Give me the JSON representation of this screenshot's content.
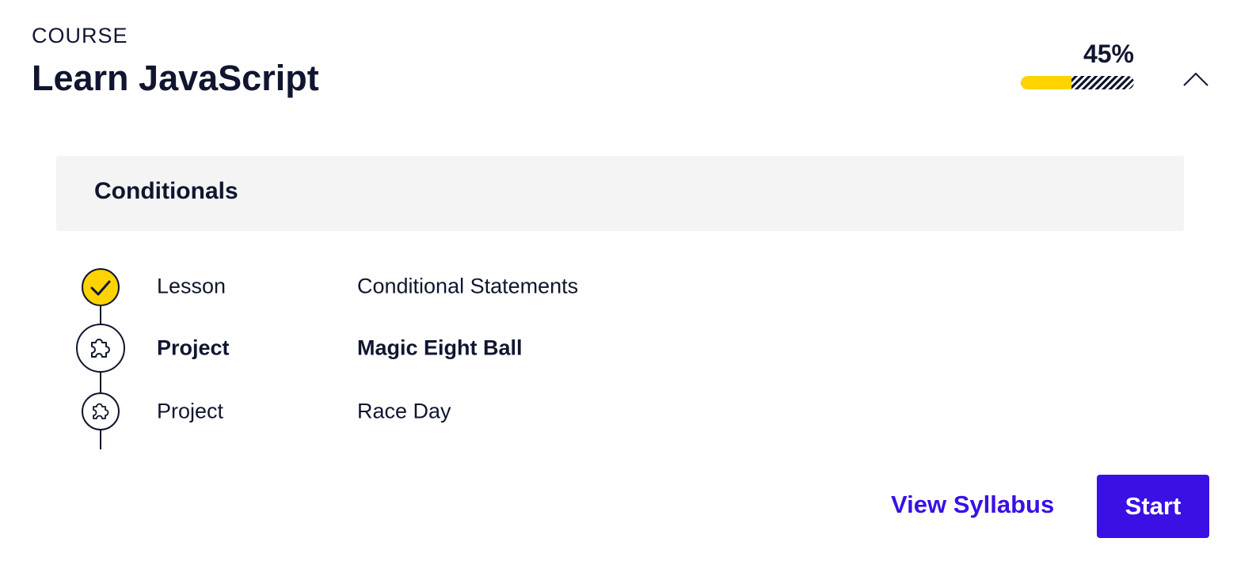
{
  "header": {
    "eyebrow": "COURSE",
    "title": "Learn JavaScript"
  },
  "progress": {
    "label": "45%",
    "fraction": 0.45,
    "fill_color": "#ffd300"
  },
  "collapse_icon": "chevron-up-icon",
  "module": {
    "title": "Conditionals",
    "items": [
      {
        "type": "Lesson",
        "name": "Conditional Statements",
        "status": "completed",
        "icon": "checkmark-icon"
      },
      {
        "type": "Project",
        "name": "Magic Eight Ball",
        "status": "current",
        "icon": "puzzle-piece-icon"
      },
      {
        "type": "Project",
        "name": "Race Day",
        "status": "upcoming",
        "icon": "puzzle-piece-icon"
      }
    ]
  },
  "actions": {
    "syllabus_label": "View Syllabus",
    "start_label": "Start"
  },
  "colors": {
    "text": "#10162f",
    "accent": "#3a10e5",
    "highlight": "#ffd300",
    "module_bg": "#f4f4f4"
  }
}
